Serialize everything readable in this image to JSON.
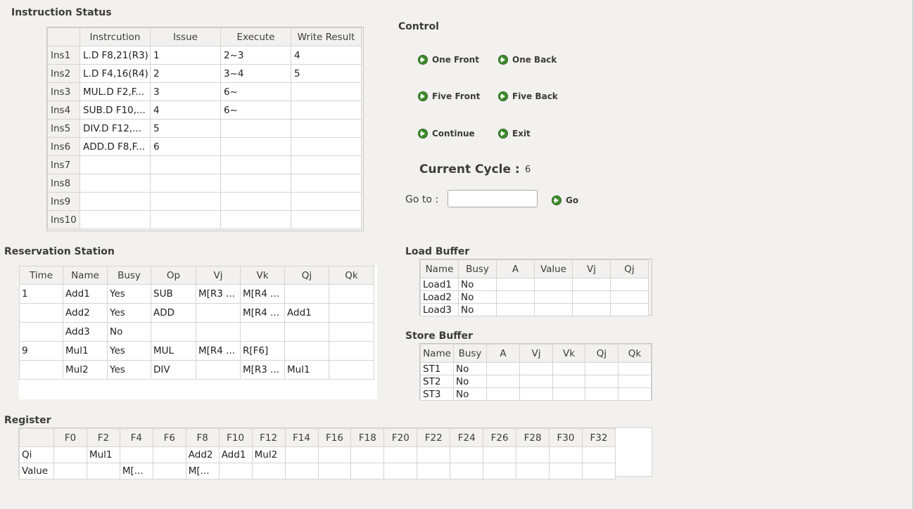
{
  "instruction_status": {
    "title": "Instruction Status",
    "columns": [
      "",
      "Instrcution",
      "Issue",
      "Execute",
      "Write Result"
    ],
    "rows": [
      {
        "id": "Ins1",
        "instr": "L.D F8,21(R3)",
        "issue": "1",
        "execute": "2~3",
        "write": "4"
      },
      {
        "id": "Ins2",
        "instr": "L.D F4,16(R4)",
        "issue": "2",
        "execute": "3~4",
        "write": "5"
      },
      {
        "id": "Ins3",
        "instr": "MUL.D F2,F...",
        "issue": "3",
        "execute": "6~",
        "write": ""
      },
      {
        "id": "Ins4",
        "instr": "SUB.D F10,...",
        "issue": "4",
        "execute": "6~",
        "write": ""
      },
      {
        "id": "Ins5",
        "instr": "DIV.D F12,...",
        "issue": "5",
        "execute": "",
        "write": ""
      },
      {
        "id": "Ins6",
        "instr": "ADD.D F8,F...",
        "issue": "6",
        "execute": "",
        "write": ""
      },
      {
        "id": "Ins7",
        "instr": "",
        "issue": "",
        "execute": "",
        "write": ""
      },
      {
        "id": "Ins8",
        "instr": "",
        "issue": "",
        "execute": "",
        "write": ""
      },
      {
        "id": "Ins9",
        "instr": "",
        "issue": "",
        "execute": "",
        "write": ""
      },
      {
        "id": "Ins10",
        "instr": "",
        "issue": "",
        "execute": "",
        "write": ""
      }
    ]
  },
  "control": {
    "title": "Control",
    "buttons": {
      "one_front": "One Front",
      "one_back": "One Back",
      "five_front": "Five Front",
      "five_back": "Five Back",
      "continue": "Continue",
      "exit": "Exit"
    },
    "current_cycle_label": "Current Cycle :",
    "current_cycle_value": "6",
    "goto_label": "Go to :",
    "goto_value": "",
    "go_button": "Go"
  },
  "reservation_station": {
    "title": "Reservation Station",
    "columns": [
      "Time",
      "Name",
      "Busy",
      "Op",
      "Vj",
      "Vk",
      "Qj",
      "Qk"
    ],
    "rows": [
      {
        "time": "1",
        "name": "Add1",
        "busy": "Yes",
        "op": "SUB",
        "vj": "M[R3 ...",
        "vk": "M[R4 ...",
        "qj": "",
        "qk": ""
      },
      {
        "time": "",
        "name": "Add2",
        "busy": "Yes",
        "op": "ADD",
        "vj": "",
        "vk": "M[R4 ...",
        "qj": "Add1",
        "qk": ""
      },
      {
        "time": "",
        "name": "Add3",
        "busy": "No",
        "op": "",
        "vj": "",
        "vk": "",
        "qj": "",
        "qk": ""
      },
      {
        "time": "9",
        "name": "Mul1",
        "busy": "Yes",
        "op": "MUL",
        "vj": "M[R4 ...",
        "vk": "R[F6]",
        "qj": "",
        "qk": ""
      },
      {
        "time": "",
        "name": "Mul2",
        "busy": "Yes",
        "op": "DIV",
        "vj": "",
        "vk": "M[R3 ...",
        "qj": "Mul1",
        "qk": ""
      }
    ]
  },
  "load_buffer": {
    "title": "Load Buffer",
    "columns": [
      "Name",
      "Busy",
      "A",
      "Value",
      "Vj",
      "Qj"
    ],
    "rows": [
      {
        "name": "Load1",
        "busy": "No",
        "a": "",
        "value": "",
        "vj": "",
        "qj": ""
      },
      {
        "name": "Load2",
        "busy": "No",
        "a": "",
        "value": "",
        "vj": "",
        "qj": ""
      },
      {
        "name": "Load3",
        "busy": "No",
        "a": "",
        "value": "",
        "vj": "",
        "qj": ""
      }
    ]
  },
  "store_buffer": {
    "title": "Store Buffer",
    "columns": [
      "Name",
      "Busy",
      "A",
      "Vj",
      "Vk",
      "Qj",
      "Qk"
    ],
    "rows": [
      {
        "name": "ST1",
        "busy": "No",
        "a": "",
        "vj": "",
        "vk": "",
        "qj": "",
        "qk": ""
      },
      {
        "name": "ST2",
        "busy": "No",
        "a": "",
        "vj": "",
        "vk": "",
        "qj": "",
        "qk": ""
      },
      {
        "name": "ST3",
        "busy": "No",
        "a": "",
        "vj": "",
        "vk": "",
        "qj": "",
        "qk": ""
      }
    ]
  },
  "register": {
    "title": "Register",
    "columns": [
      "",
      "F0",
      "F2",
      "F4",
      "F6",
      "F8",
      "F10",
      "F12",
      "F14",
      "F16",
      "F18",
      "F20",
      "F22",
      "F24",
      "F26",
      "F28",
      "F30",
      "F32"
    ],
    "rows": [
      {
        "label": "Qi",
        "cells": [
          "",
          "Mul1",
          "",
          "",
          "Add2",
          "Add1",
          "Mul2",
          "",
          "",
          "",
          "",
          "",
          "",
          "",
          "",
          "",
          ""
        ]
      },
      {
        "label": "Value",
        "cells": [
          "",
          "",
          "M[...",
          "",
          "M[...",
          "",
          "",
          "",
          "",
          "",
          "",
          "",
          "",
          "",
          "",
          "",
          ""
        ]
      }
    ]
  },
  "icons": {
    "go": "go-arrow-icon"
  },
  "colors": {
    "icon_green": "#3e8b2b",
    "background": "#f2f1f0",
    "grid_line": "#d4d4d4"
  }
}
